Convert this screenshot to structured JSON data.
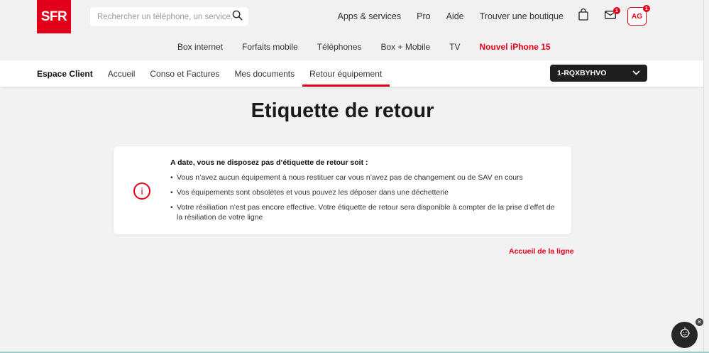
{
  "header": {
    "logo": "SFR",
    "search_placeholder": "Rechercher un téléphone, un service, …",
    "top_links": [
      "Apps & services",
      "Pro",
      "Aide",
      "Trouver une boutique"
    ],
    "mail_badge": "1",
    "avatar": "AG",
    "avatar_badge": "1",
    "main_nav": [
      "Box internet",
      "Forfaits mobile",
      "Téléphones",
      "Box + Mobile",
      "TV",
      "Nouvel iPhone 15"
    ]
  },
  "subnav": {
    "brand": "Espace Client",
    "items": [
      "Accueil",
      "Conso et Factures",
      "Mes documents",
      "Retour équipement"
    ],
    "line_select": "1-RQXBYHVO"
  },
  "main": {
    "title": "Etiquette de retour",
    "info_title": "A date, vous ne disposez pas d’étiquette de retour soit :",
    "bullets": [
      "Vous n’avez aucun équipement à nous restituer car vous n’avez pas de changement ou de SAV en cours",
      "Vos équipements sont obsolètes et vous pouvez les déposer dans une déchetterie",
      "Votre résiliation n’est pas encore effective. Votre étiquette de retour sera disponible à compter de la prise d’effet de la résiliation de votre ligne"
    ],
    "back_link": "Accueil de la ligne"
  },
  "colors": {
    "brand": "#e2001a",
    "dark": "#1f1f1f"
  }
}
